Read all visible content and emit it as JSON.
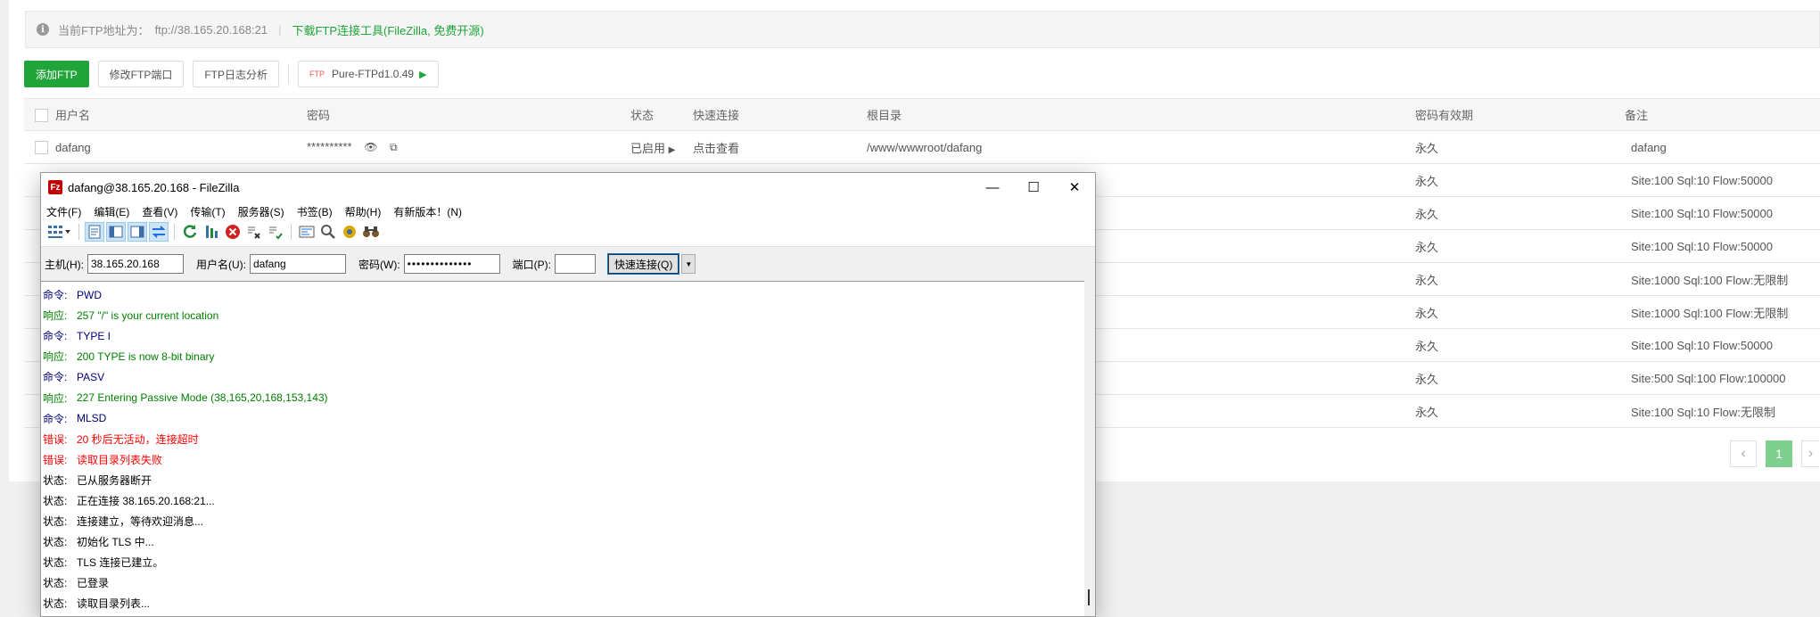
{
  "notice": {
    "ftp_address_label": "当前FTP地址为：",
    "ftp_address": "ftp://38.165.20.168:21",
    "download_link": "下载FTP连接工具(FileZilla, 免费开源)"
  },
  "toolbar": {
    "add_ftp": "添加FTP",
    "modify_port": "修改FTP端口",
    "log_analysis": "FTP日志分析",
    "ftp_icon_text": "FTP",
    "pure_ftpd": "Pure-FTPd1.0.49"
  },
  "table": {
    "headers": [
      "用户名",
      "密码",
      "状态",
      "快速连接",
      "根目录",
      "密码有效期",
      "备注"
    ],
    "first_row": {
      "username": "dafang",
      "password": "**********",
      "status": "已启用",
      "quick_connect": "点击查看",
      "root_dir": "/www/wwwroot/dafang",
      "validity": "永久",
      "remark": "dafang"
    },
    "hidden_rows": [
      {
        "validity": "永久",
        "remark": "Site:100 Sql:10 Flow:50000"
      },
      {
        "validity": "永久",
        "remark": "Site:100 Sql:10 Flow:50000"
      },
      {
        "validity": "永久",
        "remark": "Site:100 Sql:10 Flow:50000"
      },
      {
        "validity": "永久",
        "remark": "Site:1000 Sql:100 Flow:无限制"
      },
      {
        "validity": "永久",
        "remark": "Site:1000 Sql:100 Flow:无限制"
      },
      {
        "validity": "永久",
        "remark": "Site:100 Sql:10 Flow:50000"
      },
      {
        "validity": "永久",
        "remark": "Site:500 Sql:100 Flow:100000"
      },
      {
        "validity": "永久",
        "remark": "Site:100 Sql:10 Flow:无限制"
      }
    ]
  },
  "pager": {
    "prev": "‹",
    "current": "1",
    "next": "›"
  },
  "filezilla": {
    "title": "dafang@38.165.20.168 - FileZilla",
    "logo": "Fz",
    "menu": [
      "文件(F)",
      "编辑(E)",
      "查看(V)",
      "传输(T)",
      "服务器(S)",
      "书签(B)",
      "帮助(H)",
      "有新版本！(N)"
    ],
    "quickconnect": {
      "host_label": "主机(H):",
      "host_value": "38.165.20.168",
      "user_label": "用户名(U):",
      "user_value": "dafang",
      "pass_label": "密码(W):",
      "pass_value": "••••••••••••••",
      "port_label": "端口(P):",
      "port_value": "",
      "button": "快速连接(Q)"
    },
    "log": [
      {
        "type": "cmd",
        "label": "命令:",
        "text": "PWD"
      },
      {
        "type": "resp",
        "label": "响应:",
        "text": "257 \"/\" is your current location"
      },
      {
        "type": "cmd",
        "label": "命令:",
        "text": "TYPE I"
      },
      {
        "type": "resp",
        "label": "响应:",
        "text": "200 TYPE is now 8-bit binary"
      },
      {
        "type": "cmd",
        "label": "命令:",
        "text": "PASV"
      },
      {
        "type": "resp",
        "label": "响应:",
        "text": "227 Entering Passive Mode (38,165,20,168,153,143)"
      },
      {
        "type": "cmd",
        "label": "命令:",
        "text": "MLSD"
      },
      {
        "type": "err",
        "label": "错误:",
        "text": "20 秒后无活动，连接超时"
      },
      {
        "type": "err",
        "label": "错误:",
        "text": "读取目录列表失败"
      },
      {
        "type": "status",
        "label": "状态:",
        "text": "已从服务器断开"
      },
      {
        "type": "status",
        "label": "状态:",
        "text": "正在连接 38.165.20.168:21..."
      },
      {
        "type": "status",
        "label": "状态:",
        "text": "连接建立，等待欢迎消息..."
      },
      {
        "type": "status",
        "label": "状态:",
        "text": "初始化 TLS 中..."
      },
      {
        "type": "status",
        "label": "状态:",
        "text": "TLS 连接已建立。"
      },
      {
        "type": "status",
        "label": "状态:",
        "text": "已登录"
      },
      {
        "type": "status",
        "label": "状态:",
        "text": "读取目录列表..."
      }
    ]
  },
  "colors": {
    "accent": "#20a53a",
    "error": "#ff0000",
    "command": "#000080",
    "response": "#008000"
  }
}
